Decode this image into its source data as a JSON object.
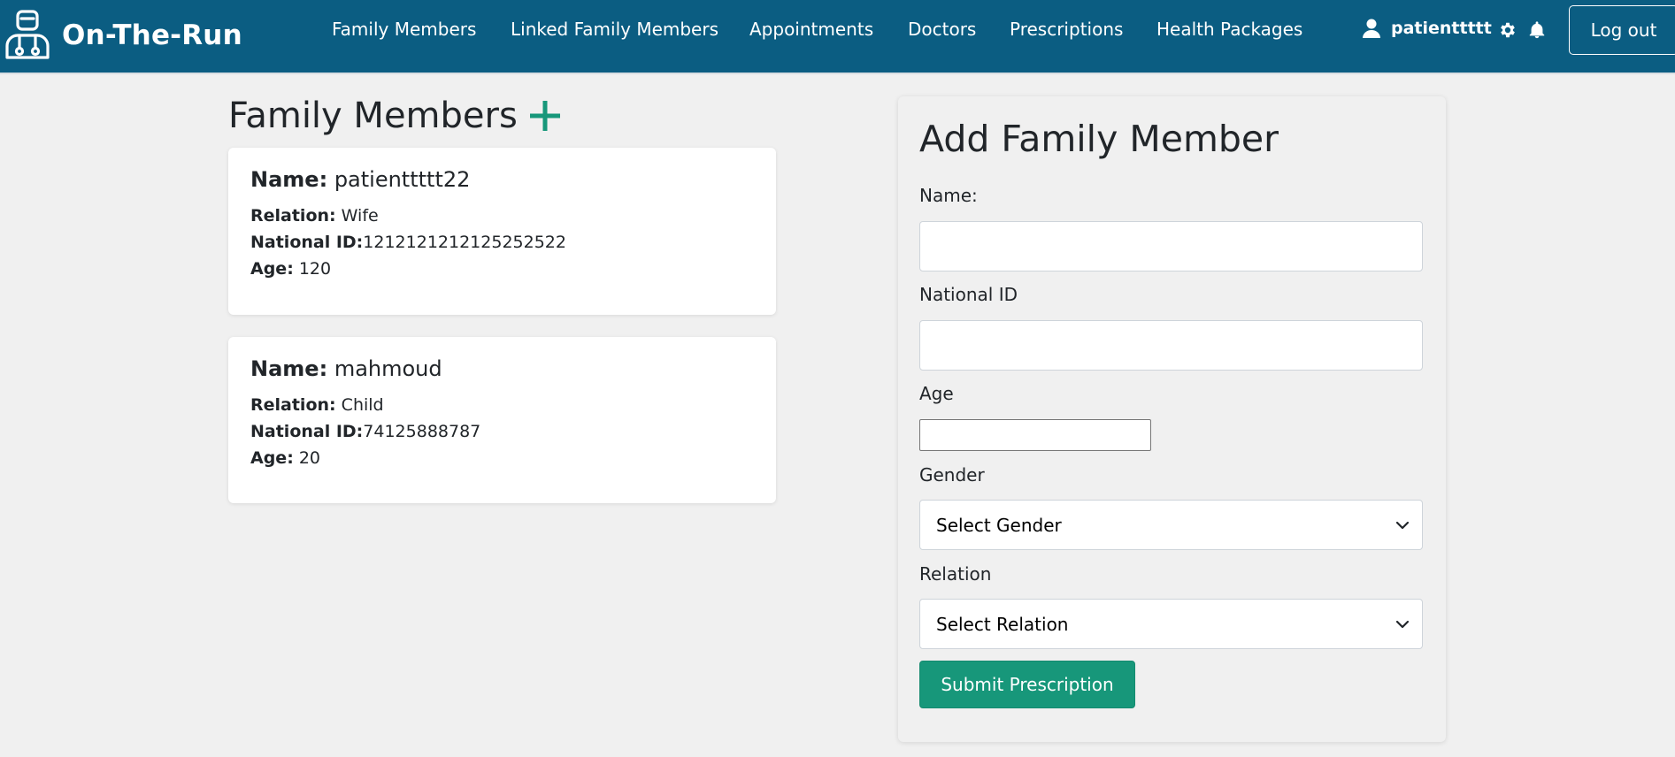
{
  "app": {
    "name": "On-The-Run"
  },
  "nav": {
    "links": [
      "Family Members",
      "Linked Family Members",
      "Appointments",
      "Doctors",
      "Prescriptions",
      "Health Packages"
    ],
    "username": "patienttttt",
    "logout_label": "Log out"
  },
  "family": {
    "title": "Family Members",
    "labels": {
      "name": "Name:",
      "relation": "Relation:",
      "national_id": "National ID:",
      "age": "Age:"
    },
    "members": [
      {
        "name": "patienttttt22",
        "relation": "Wife",
        "national_id": "1212121212125252522",
        "age": "120"
      },
      {
        "name": "mahmoud",
        "relation": "Child",
        "national_id": "74125888787",
        "age": "20"
      }
    ]
  },
  "form": {
    "title": "Add Family Member",
    "name_label": "Name:",
    "name_value": "",
    "national_id_label": "National ID",
    "national_id_value": "",
    "age_label": "Age",
    "age_value": "",
    "gender_label": "Gender",
    "gender_selected": "Select Gender",
    "relation_label": "Relation",
    "relation_selected": "Select Relation",
    "submit_label": "Submit Prescription"
  },
  "colors": {
    "navbar": "#0b5d82",
    "accent": "#17977a",
    "background": "#f0f0f0"
  }
}
